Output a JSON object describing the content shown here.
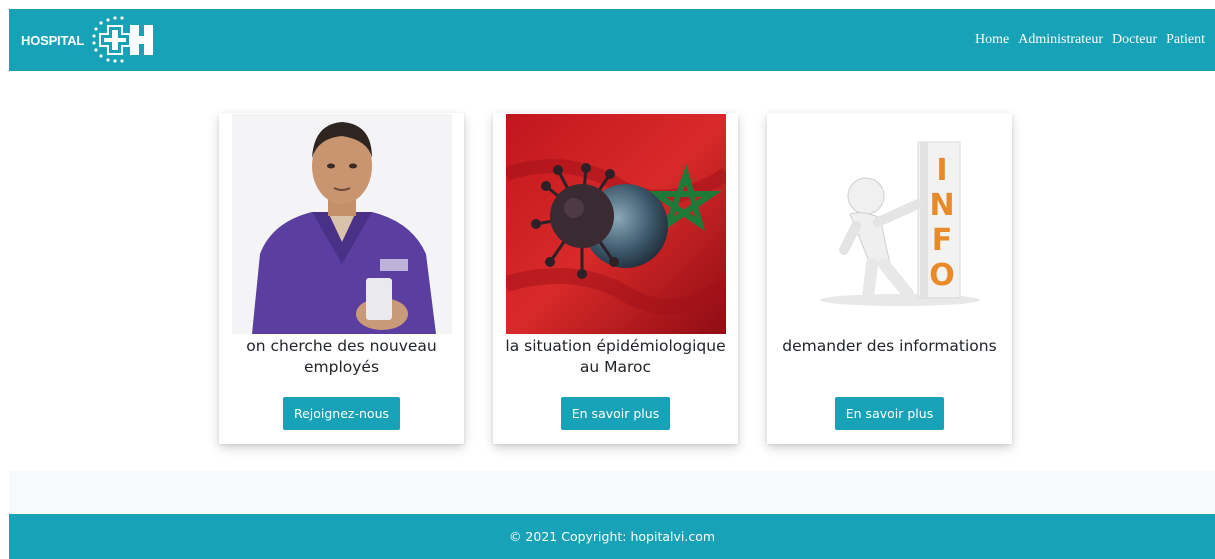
{
  "brand": {
    "text": "HOSPITAL",
    "logo_icon": "hospital-cross-logo"
  },
  "nav": {
    "items": [
      "Home",
      "Administrateur",
      "Docteur",
      "Patient"
    ]
  },
  "cards": [
    {
      "title": "on cherche des nouveau employés",
      "button": "Rejoignez-nous",
      "image": "doctor-photo"
    },
    {
      "title": "la situation épidémiologique au Maroc",
      "button": "En savoir plus",
      "image": "virus-morocco-flag"
    },
    {
      "title": "demander des informations",
      "button": "En savoir plus",
      "image": "info-figure"
    }
  ],
  "footer": {
    "text": "© 2021 Copyright: hopitalvi.com"
  },
  "colors": {
    "primary": "#17a2b8",
    "light": "#f8f9fa"
  }
}
